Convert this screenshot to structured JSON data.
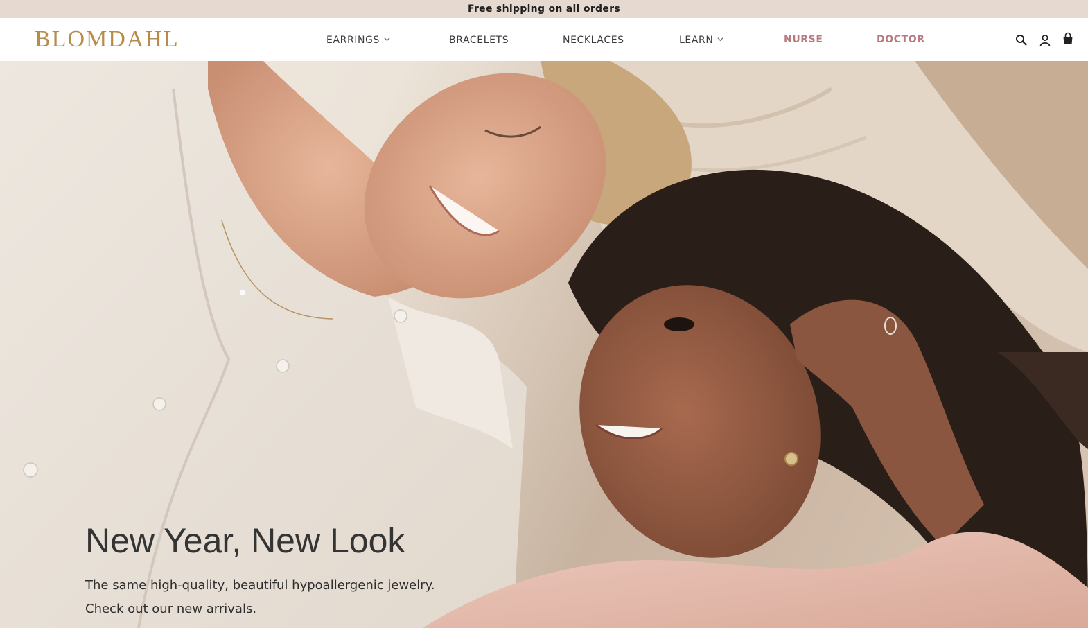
{
  "announcement": {
    "text": "Free shipping on all orders"
  },
  "header": {
    "logo": "BLOMDAHL",
    "nav": [
      {
        "label": "EARRINGS",
        "has_dropdown": true
      },
      {
        "label": "BRACELETS",
        "has_dropdown": false
      },
      {
        "label": "NECKLACES",
        "has_dropdown": false
      },
      {
        "label": "LEARN",
        "has_dropdown": true
      },
      {
        "label": "NURSE",
        "has_dropdown": false,
        "accent": true
      },
      {
        "label": "DOCTOR",
        "has_dropdown": false,
        "accent": true
      }
    ],
    "icons": [
      "search-icon",
      "account-icon",
      "cart-icon"
    ]
  },
  "hero": {
    "title": "New Year, New Look",
    "subtitle": "The same high-quality, beautiful hypoallergenic jewelry. Check out our new arrivals."
  },
  "colors": {
    "brand_gold": "#b78b49",
    "accent_rose": "#b87a7f",
    "announcement_bg": "#e6d9cf"
  }
}
